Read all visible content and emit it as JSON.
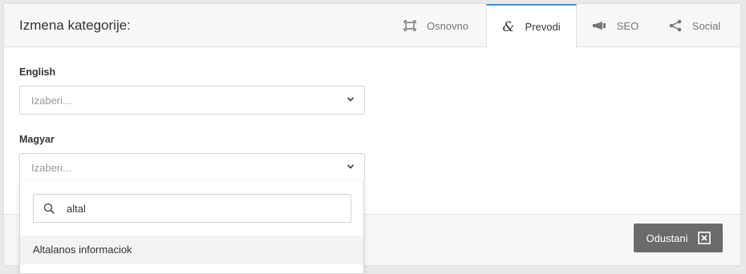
{
  "header": {
    "title": "Izmena kategorije:",
    "tabs": [
      {
        "label": "Osnovno",
        "icon": "frame-icon"
      },
      {
        "label": "Prevodi",
        "icon": "ampersand-icon",
        "active": true
      },
      {
        "label": "SEO",
        "icon": "megaphone-icon"
      },
      {
        "label": "Social",
        "icon": "share-icon"
      }
    ]
  },
  "form": {
    "fields": [
      {
        "label": "English",
        "placeholder": "Izaberi..."
      },
      {
        "label": "Magyar",
        "placeholder": "Izaberi..."
      }
    ]
  },
  "dropdown": {
    "search_value": "altal",
    "options": [
      {
        "label": "Altalanos informaciok"
      }
    ]
  },
  "footer": {
    "cancel_label": "Odustani"
  },
  "colors": {
    "active_tab_accent": "#3a93d8",
    "cancel_button": "#6b6b6b"
  }
}
